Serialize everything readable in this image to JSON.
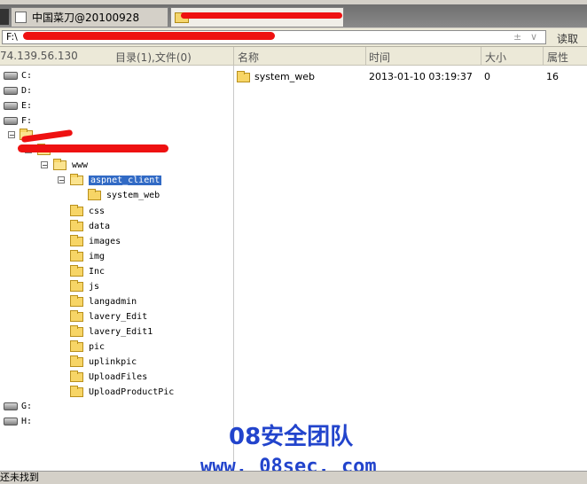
{
  "tabs": [
    {
      "label": "中国菜刀@20100928",
      "active": false
    },
    {
      "label": "",
      "active": true
    }
  ],
  "address": {
    "value": "F:\\",
    "extra_btn": "±",
    "dropdown": "∨",
    "read_label": "读取"
  },
  "left_header": {
    "ip": "74.139.56.130",
    "summary": "目录(1),文件(0)"
  },
  "columns": {
    "name": "名称",
    "time": "时间",
    "size": "大小",
    "attr": "属性"
  },
  "tree": {
    "drives": [
      "C:",
      "D:",
      "E:",
      "F:"
    ],
    "drives_bottom": [
      "G:",
      "H:"
    ],
    "www": "www",
    "aspnet_client": "aspnet_client",
    "system_web": "system_web",
    "folders": [
      "css",
      "data",
      "images",
      "img",
      "Inc",
      "js",
      "langadmin",
      "lavery_Edit",
      "lavery_Edit1",
      "pic",
      "uplinkpic",
      "UploadFiles",
      "UploadProductPic"
    ]
  },
  "files": [
    {
      "name": "system_web",
      "time": "2013-01-10 03:19:37",
      "size": "0",
      "attr": "16"
    }
  ],
  "watermark": {
    "title": "08安全团队",
    "url": "www. 08sec. com"
  },
  "status": "还未找到"
}
